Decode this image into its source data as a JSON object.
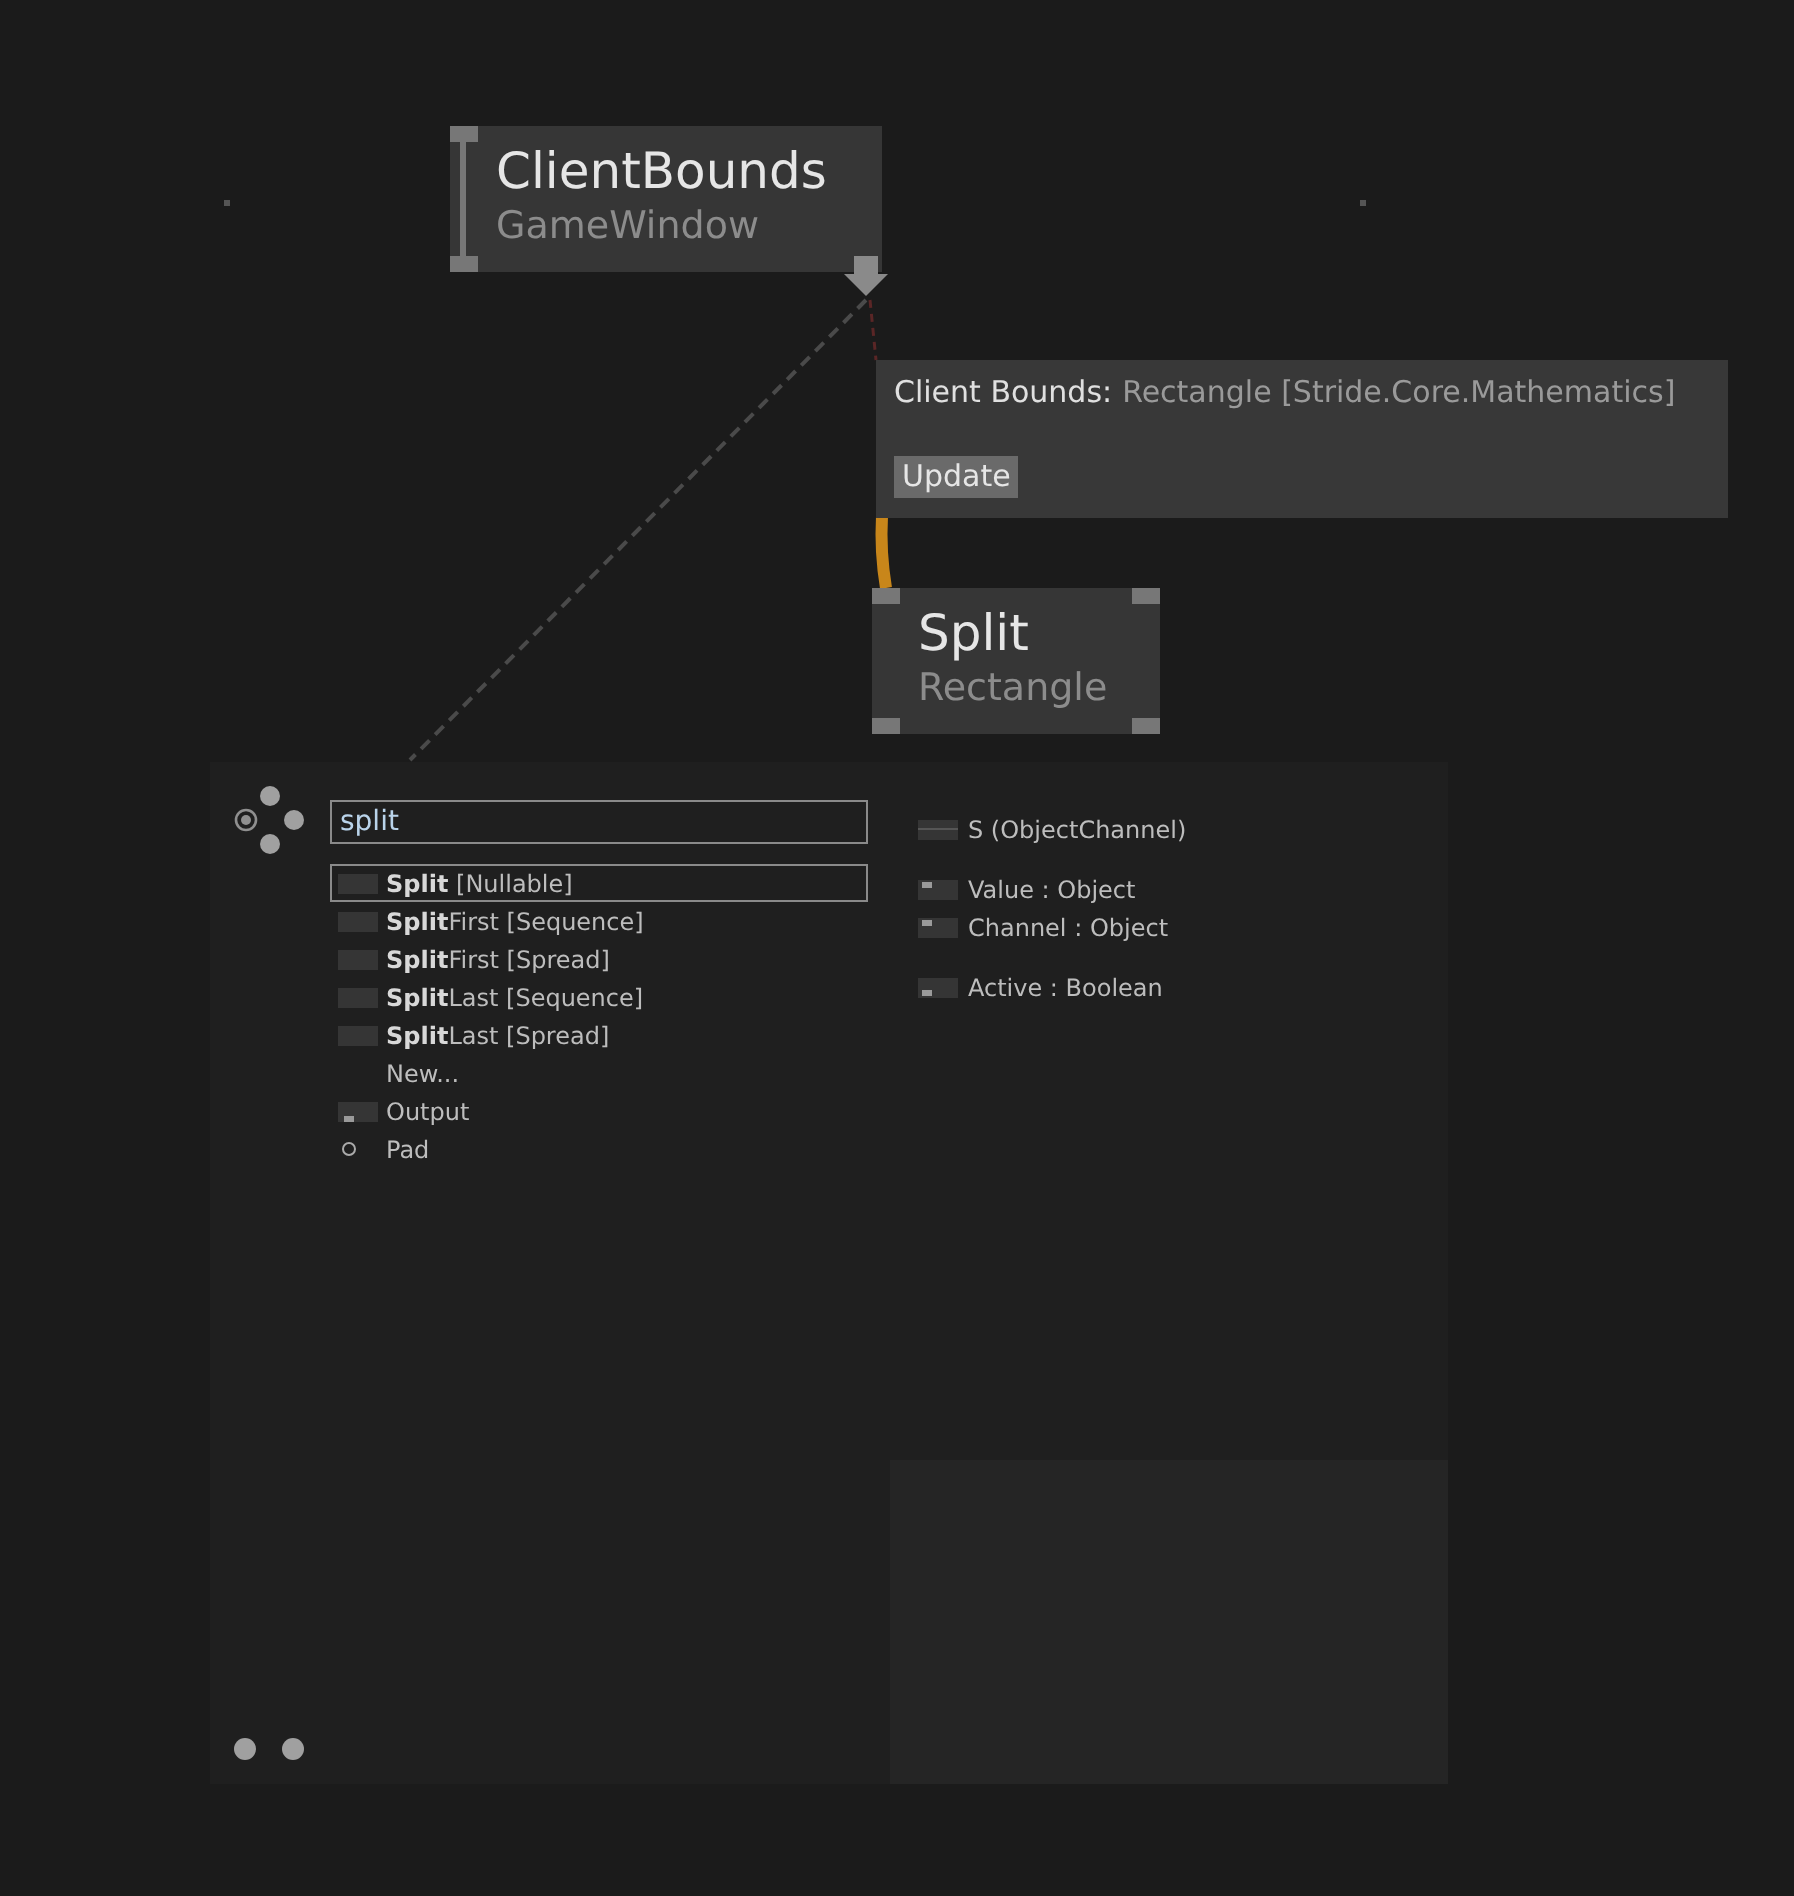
{
  "nodes": [
    {
      "kind": "input",
      "title": "ClientBounds",
      "subtitle": "GameWindow"
    },
    {
      "kind": "plain",
      "title": "Split",
      "subtitle": "Rectangle"
    }
  ],
  "tooltip": {
    "label": "Client Bounds:",
    "type": "Rectangle [Stride.Core.Mathematics]",
    "button": "Update"
  },
  "node_browser": {
    "search": {
      "value": "split"
    },
    "results": [
      {
        "kind": "node",
        "text": "**Split** [Nullable]",
        "selected": true
      },
      {
        "kind": "node",
        "text": "**Split**First [Sequence]",
        "selected": false
      },
      {
        "kind": "node",
        "text": "**Split**First [Spread]",
        "selected": false
      },
      {
        "kind": "node",
        "text": "**Split**Last [Sequence]",
        "selected": false
      },
      {
        "kind": "node",
        "text": "**Split**Last [Spread]",
        "selected": false
      },
      {
        "kind": "plain",
        "text": "New...",
        "selected": false
      },
      {
        "kind": "output",
        "text": "Output",
        "selected": false
      },
      {
        "kind": "pad",
        "text": "Pad",
        "selected": false
      }
    ],
    "pins": [
      [
        {
          "kind": "channel",
          "text": "S (ObjectChannel)"
        }
      ],
      [
        {
          "kind": "input",
          "text": "Value : Object"
        },
        {
          "kind": "input",
          "text": "Channel : Object"
        }
      ],
      [
        {
          "kind": "toggle",
          "text": "Active : Boolean"
        }
      ]
    ]
  }
}
